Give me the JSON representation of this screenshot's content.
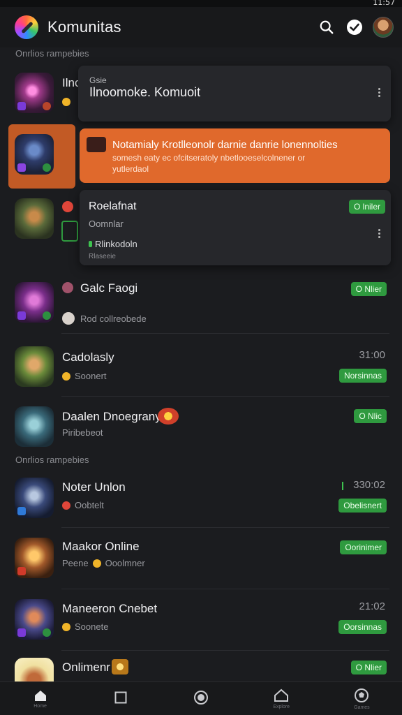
{
  "status_bar": {
    "time": "11:57"
  },
  "app_bar": {
    "title": "Komunitas"
  },
  "sections": {
    "first": "Onrlios rampebies",
    "second": "Onrlios rampebies"
  },
  "popup_top": {
    "prefix": "Ilnc",
    "label": "Gsie",
    "title": "Ilnoomoke. Komuoit"
  },
  "notification": {
    "title": "Notamialy Krotlleonolr darnie danrie lonennolties",
    "body_line1": "somesh eaty ec ofcitseratoly nbetlooeselcolnener or",
    "body_line2": "yutlerdaol"
  },
  "popup_mid": {
    "title": "Roelafnat",
    "subtitle": "Oomnlar",
    "status": "Rlinkodoln",
    "note": "Rlaseeie",
    "badge": "O lniler"
  },
  "rows": [
    {
      "title": "Galc Faogi",
      "subtitle": "Rod collreobede",
      "badge": "O Nlier"
    },
    {
      "title": "Cadolasly",
      "subtitle": "Soonert",
      "time": "31:00",
      "badge": "Norsinnas"
    },
    {
      "title": "Daalen Dnoegrany",
      "subtitle": "Piribebeot",
      "badge": "O Nlic"
    },
    {
      "title": "Noter Unlon",
      "subtitle": "Oobtelt",
      "time": "330:02",
      "badge": "Obelisnert"
    },
    {
      "title": "Maakor Online",
      "subtitle_prefix": "Peene",
      "subtitle": "Ooolmner",
      "badge": "Oorinimer"
    },
    {
      "title": "Maneeron Cnebet",
      "subtitle": "Soonete",
      "time": "21:02",
      "badge": "Oorsinnas"
    },
    {
      "title": "Onlimenr",
      "badge": "O Nlier"
    }
  ],
  "bottom_nav": [
    {
      "icon": "home-icon",
      "label": "Home"
    },
    {
      "icon": "square-icon",
      "label": ""
    },
    {
      "icon": "circle-icon",
      "label": ""
    },
    {
      "icon": "house-outline-icon",
      "label": "Explore"
    },
    {
      "icon": "soccer-ball-icon",
      "label": "Games"
    }
  ]
}
